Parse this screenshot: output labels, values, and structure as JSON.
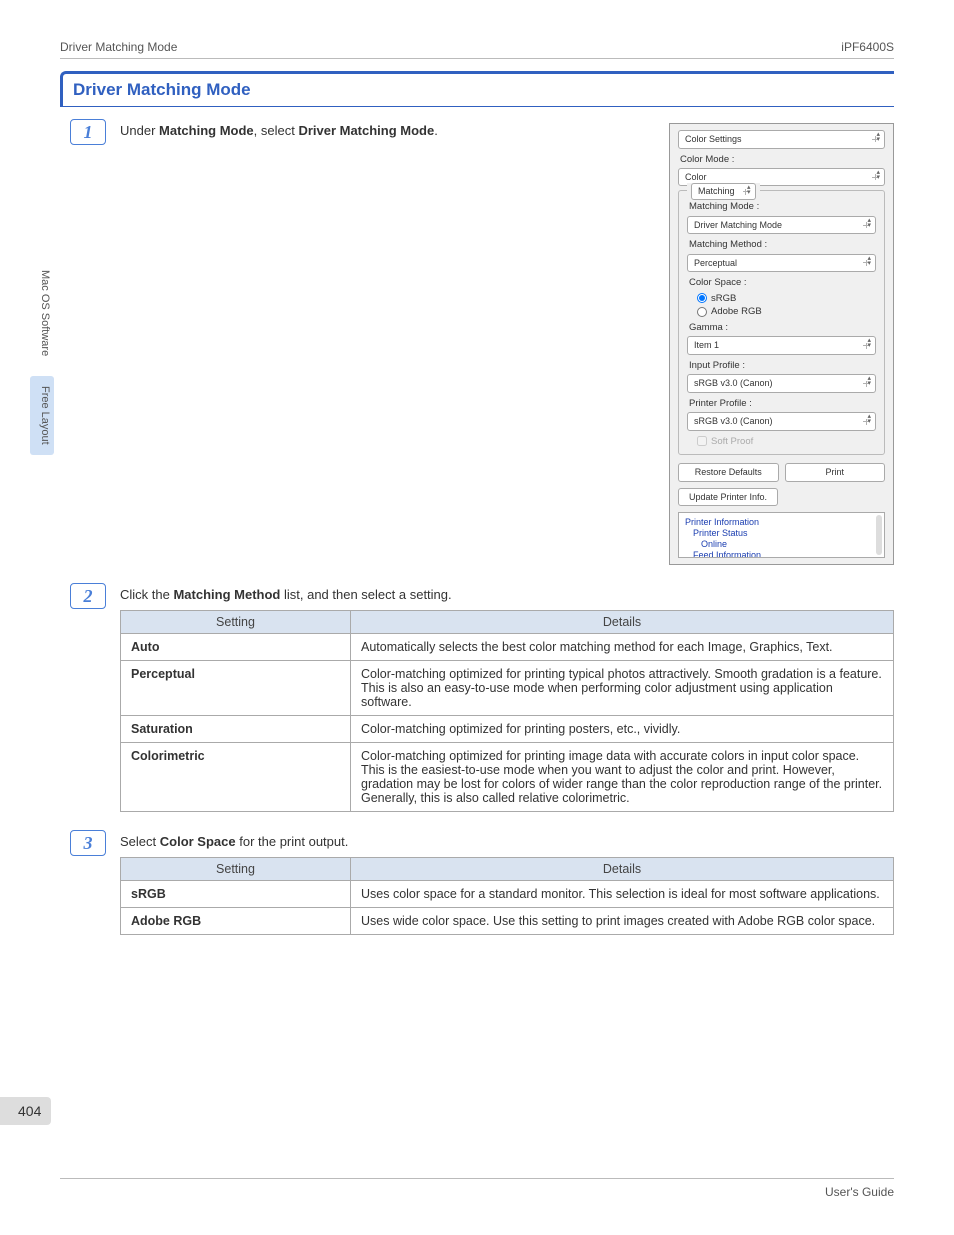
{
  "header": {
    "left": "Driver Matching Mode",
    "right": "iPF6400S"
  },
  "section_title": "Driver Matching Mode",
  "side_tabs": [
    {
      "label": "Mac OS Software",
      "active": false
    },
    {
      "label": "Free Layout",
      "active": true
    }
  ],
  "steps": {
    "s1": {
      "num": "1",
      "text_pre": "Under ",
      "bold1": "Matching Mode",
      "mid": ", select ",
      "bold2": "Driver Matching Mode",
      "post": "."
    },
    "s2": {
      "num": "2",
      "text_pre": "Click the ",
      "bold": "Matching Method",
      "post": " list, and then select a setting."
    },
    "s3": {
      "num": "3",
      "text_pre": "Select ",
      "bold": "Color Space",
      "post": " for the print output."
    }
  },
  "dialog": {
    "panel": "Color Settings",
    "color_mode_label": "Color Mode :",
    "color_value": "Color",
    "matching_label": "Matching",
    "matching_mode_label": "Matching Mode :",
    "matching_mode_value": "Driver Matching Mode",
    "matching_method_label": "Matching Method :",
    "matching_method_value": "Perceptual",
    "color_space_label": "Color Space :",
    "cs_srgb": "sRGB",
    "cs_adobe": "Adobe RGB",
    "gamma_label": "Gamma :",
    "gamma_value": "Item 1",
    "input_profile_label": "Input Profile :",
    "input_profile_value": "sRGB v3.0 (Canon)",
    "printer_profile_label": "Printer Profile :",
    "printer_profile_value": "sRGB v3.0 (Canon)",
    "soft_proof": "Soft Proof",
    "restore": "Restore Defaults",
    "print": "Print",
    "update": "Update Printer Info.",
    "status_title": "Printer Information",
    "status_l1": "Printer Status",
    "status_l2": "Online",
    "status_l3": "Feed Information"
  },
  "table_headers": {
    "setting": "Setting",
    "details": "Details"
  },
  "table2": [
    {
      "name": "Auto",
      "details": "Automatically selects the best color matching method for each Image, Graphics, Text."
    },
    {
      "name": "Perceptual",
      "details": "Color-matching optimized for printing typical photos attractively. Smooth gradation is a feature. This is also an easy-to-use mode when performing color adjustment using application software."
    },
    {
      "name": "Saturation",
      "details": "Color-matching optimized for printing posters, etc., vividly."
    },
    {
      "name": "Colorimetric",
      "details": "Color-matching optimized for printing image data with accurate colors in input color space. This is the easiest-to-use mode when you want to adjust the color and print. However, gradation may be lost for colors of wider range than the color reproduction range of the printer. Generally, this is also called relative colorimetric."
    }
  ],
  "table3": [
    {
      "name": "sRGB",
      "details": "Uses color space for a standard monitor. This selection is ideal for most software applications."
    },
    {
      "name": "Adobe RGB",
      "details": "Uses wide color space. Use this setting to print images created with Adobe RGB color space."
    }
  ],
  "page_num": "404",
  "footer": "User's Guide"
}
